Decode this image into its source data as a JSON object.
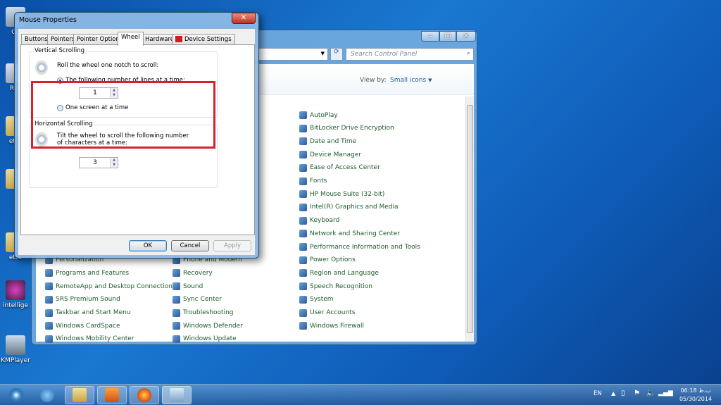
{
  "desktop": {
    "icons": [
      "Co",
      "Rec",
      "etra",
      "",
      "etra",
      "intellige",
      "KMPlayer"
    ]
  },
  "control_panel": {
    "search_placeholder": "Search Control Panel",
    "view_by_label": "View by:",
    "view_by_value": "Small icons",
    "columns": [
      [
        "Personalization",
        "Programs and Features",
        "RemoteApp and Desktop Connections",
        "SRS Premium Sound",
        "Taskbar and Start Menu",
        "Windows CardSpace",
        "Windows Mobility Center"
      ],
      [
        "Phone and Modem",
        "Recovery",
        "Sound",
        "Sync Center",
        "Troubleshooting",
        "Windows Defender",
        "Windows Update"
      ],
      [
        "AutoPlay",
        "BitLocker Drive Encryption",
        "Date and Time",
        "Device Manager",
        "Ease of Access Center",
        "Fonts",
        "HP  Mouse Suite (32-bit)",
        "Intel(R) Graphics and Media",
        "Keyboard",
        "Network and Sharing Center",
        "Performance Information and Tools",
        "Power Options",
        "Region and Language",
        "Speech Recognition",
        "System",
        "User Accounts",
        "Windows Firewall"
      ]
    ]
  },
  "dialog": {
    "title": "Mouse Properties",
    "tabs": [
      "Buttons",
      "Pointers",
      "Pointer Options",
      "Wheel",
      "Hardware",
      "Device Settings"
    ],
    "active_tab": "Wheel",
    "vertical": {
      "legend": "Vertical Scrolling",
      "desc": "Roll the wheel one notch to scroll:",
      "option1": "The following number of lines at a time:",
      "lines": "1",
      "option2": "One screen at a time",
      "selected": "option1"
    },
    "horizontal": {
      "legend": "Horizontal Scrolling",
      "desc1": "Tilt the wheel to scroll the following number",
      "desc2": "of characters at a time:",
      "chars": "3"
    },
    "ok": "OK",
    "cancel": "Cancel",
    "apply": "Apply",
    "highlight_color": "#d8202a"
  },
  "taskbar": {
    "lang": "EN",
    "time": "06:18 ب.ظ",
    "date": "05/30/2014"
  }
}
